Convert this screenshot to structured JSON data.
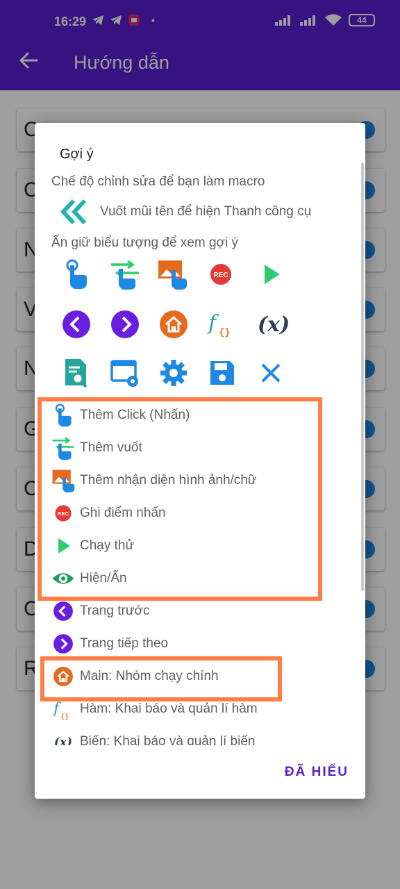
{
  "status_bar": {
    "time": "16:29",
    "battery": "44"
  },
  "app_bar": {
    "title": "Hướng dẫn"
  },
  "background_list": {
    "letters": [
      "C",
      "C",
      "N",
      "V",
      "N",
      "G",
      "C",
      "D",
      "C",
      "R"
    ]
  },
  "dialog": {
    "title": "Gợi ý",
    "edit_mode_text": "Chế độ chỉnh sửa để bạn làm macro",
    "swipe_hint": "Vuốt mũi tên để hiện Thanh công cụ",
    "long_press_hint": "Ấn giữ biểu tượng để xem gợi ý",
    "icon_rows": [
      [
        "click-icon",
        "swipe-icon",
        "image-recognition-icon",
        "record-icon",
        "play-icon"
      ],
      [
        "previous-icon",
        "next-icon",
        "home-icon",
        "function-icon",
        "variable-icon"
      ],
      [
        "search-script-icon",
        "window-settings-icon",
        "gear-icon",
        "save-icon",
        "close-icon"
      ]
    ],
    "variable_glyph": "(x)",
    "legend": [
      {
        "icon": "click-icon",
        "label": "Thêm Click (Nhấn)"
      },
      {
        "icon": "swipe-icon",
        "label": "Thêm vuốt"
      },
      {
        "icon": "image-recognition-icon",
        "label": "Thêm nhận diện hình ảnh/chữ"
      },
      {
        "icon": "record-icon",
        "label": "Ghi điểm nhấn"
      },
      {
        "icon": "play-icon",
        "label": "Chạy thử"
      },
      {
        "icon": "eye-icon",
        "label": "Hiện/Ẩn"
      },
      {
        "icon": "previous-icon",
        "label": "Trang trước"
      },
      {
        "icon": "next-icon",
        "label": "Trang tiếp theo"
      },
      {
        "icon": "home-icon",
        "label": "Main: Nhóm chạy chính"
      },
      {
        "icon": "function-icon",
        "label": "Hàm: Khai báo và quản lí hàm"
      },
      {
        "icon": "variable-icon",
        "label": "Biến: Khai báo và quản lí biến"
      }
    ],
    "ok_label": "ĐÃ HIỂU"
  },
  "colors": {
    "primary": "#5a1fd0",
    "accent_blue": "#1e88e5",
    "green": "#2ecc71",
    "record_red": "#e53935",
    "home_orange": "#e66a1e",
    "highlight": "#ff7d47"
  }
}
